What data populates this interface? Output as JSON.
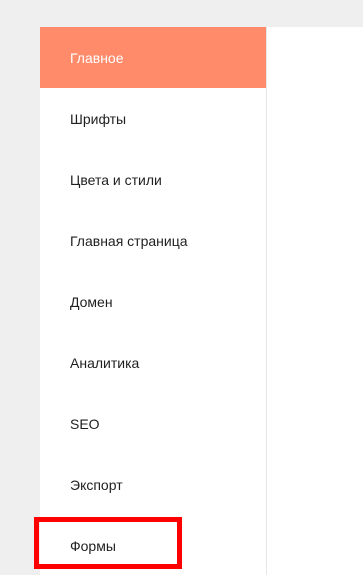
{
  "sidebar": {
    "items": [
      {
        "label": "Главное",
        "active": true
      },
      {
        "label": "Шрифты",
        "active": false
      },
      {
        "label": "Цвета и стили",
        "active": false
      },
      {
        "label": "Главная страница",
        "active": false
      },
      {
        "label": "Домен",
        "active": false
      },
      {
        "label": "Аналитика",
        "active": false
      },
      {
        "label": "SEO",
        "active": false
      },
      {
        "label": "Экспорт",
        "active": false
      },
      {
        "label": "Формы",
        "active": false
      }
    ]
  },
  "colors": {
    "active_bg": "#ff8b6b",
    "highlight_border": "#ff0000",
    "page_bg": "#efefef"
  }
}
